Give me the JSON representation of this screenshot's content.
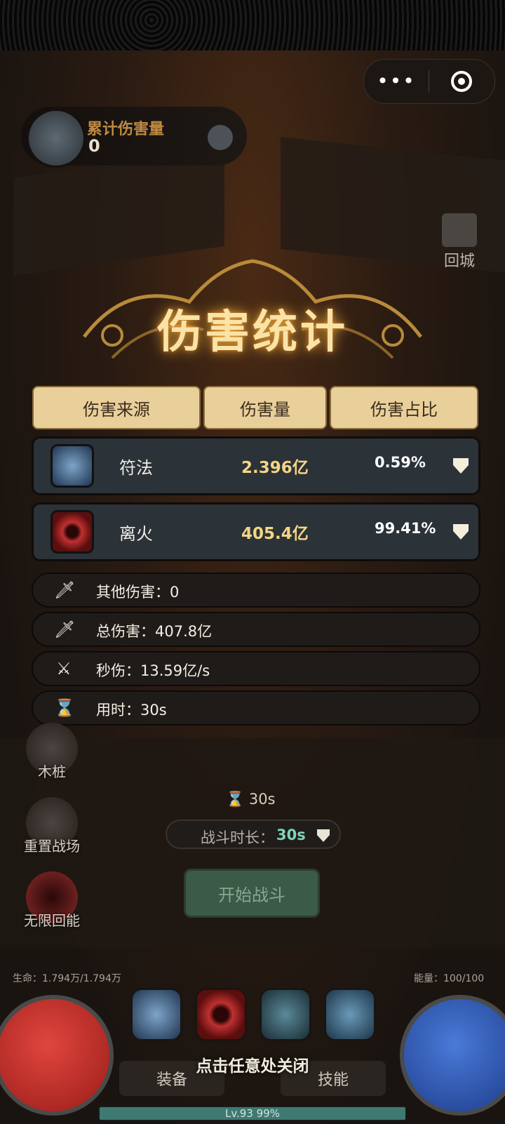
{
  "window": {
    "more_label": "•••"
  },
  "damage_hud": {
    "label": "累计伤害量",
    "value": "0"
  },
  "return_city": {
    "label": "回城"
  },
  "panel": {
    "title": "伤害统计",
    "headers": [
      "伤害来源",
      "伤害量",
      "伤害占比"
    ],
    "rows": [
      {
        "name": "符法",
        "amount": "2.396亿",
        "percent": "0.59%",
        "icon": "talisman-icon",
        "color": "#3a5c8a"
      },
      {
        "name": "离火",
        "amount": "405.4亿",
        "percent": "99.41%",
        "icon": "fire-vortex-icon",
        "color": "#8a1a1a"
      }
    ],
    "stats": [
      {
        "icon": "sword-icon",
        "text": "其他伤害：0"
      },
      {
        "icon": "sword-icon",
        "text": "总伤害：407.8亿"
      },
      {
        "icon": "sword-clock-icon",
        "text": "秒伤：13.59亿/s"
      },
      {
        "icon": "hourglass-icon",
        "text": "用时：30s"
      }
    ]
  },
  "side_menu": [
    {
      "label": "木桩",
      "icon": "dummy-icon"
    },
    {
      "label": "重置战场",
      "icon": "broom-icon"
    },
    {
      "label": "无限回能",
      "icon": "energy-orb-icon"
    }
  ],
  "battle": {
    "timer": "30s",
    "duration_label": "战斗时长：",
    "duration_value": "30s",
    "start_label": "开始战斗"
  },
  "player": {
    "hp_text": "生命：1.794万/1.794万",
    "energy_text": "能量：100/100",
    "level_text": "Lv.93  99%",
    "xp_progress": 0.99
  },
  "bottom": {
    "equip_label": "装备",
    "skill_label": "技能",
    "close_hint": "点击任意处关闭"
  },
  "colors": {
    "accent_gold": "#f5d585",
    "header_bg": "#e9cf9a",
    "row_bg": "#2b3238"
  }
}
